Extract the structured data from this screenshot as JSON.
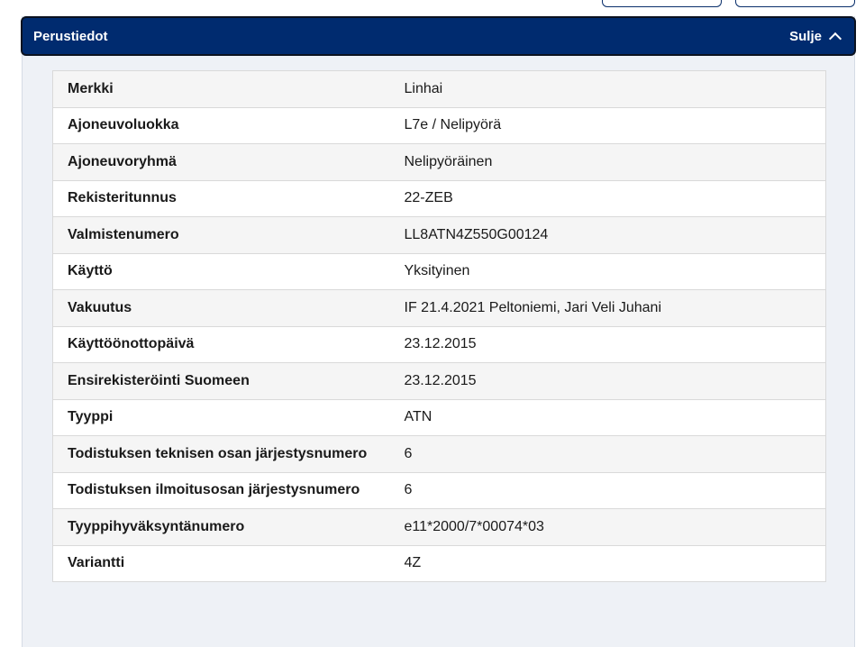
{
  "panel": {
    "title": "Perustiedot",
    "toggle_label": "Sulje"
  },
  "rows": [
    {
      "label": "Merkki",
      "value": "Linhai"
    },
    {
      "label": "Ajoneuvoluokka",
      "value": "L7e / Nelipyörä"
    },
    {
      "label": "Ajoneuvoryhmä",
      "value": "Nelipyöräinen"
    },
    {
      "label": "Rekisteritunnus",
      "value": "22-ZEB"
    },
    {
      "label": "Valmistenumero",
      "value": "LL8ATN4Z550G00124"
    },
    {
      "label": "Käyttö",
      "value": "Yksityinen"
    },
    {
      "label": "Vakuutus",
      "value": "IF 21.4.2021 Peltoniemi, Jari Veli Juhani"
    },
    {
      "label": "Käyttöönottopäivä",
      "value": "23.12.2015"
    },
    {
      "label": "Ensirekisteröinti Suomeen",
      "value": "23.12.2015"
    },
    {
      "label": "Tyyppi",
      "value": "ATN"
    },
    {
      "label": "Todistuksen teknisen osan järjestysnumero",
      "value": "6"
    },
    {
      "label": "Todistuksen ilmoitusosan järjestysnumero",
      "value": "6"
    },
    {
      "label": "Tyyppihyväksyntänumero",
      "value": "e11*2000/7*00074*03"
    },
    {
      "label": "Variantti",
      "value": "4Z"
    }
  ]
}
